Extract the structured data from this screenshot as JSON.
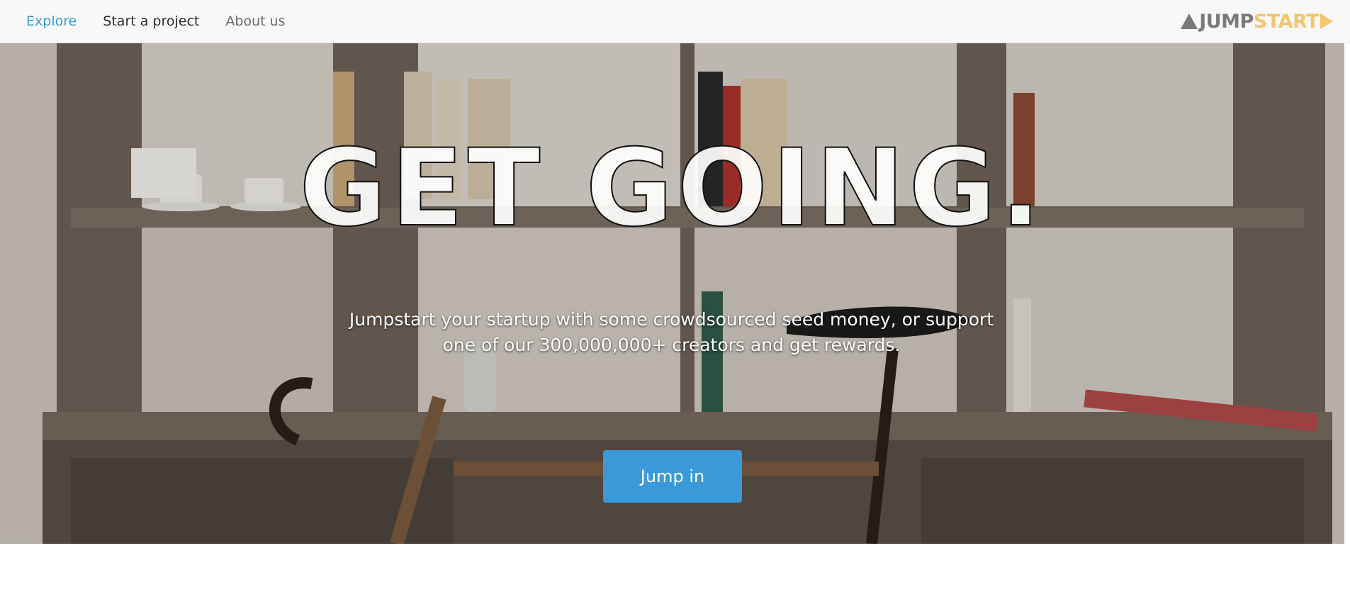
{
  "nav": {
    "links": [
      {
        "label": "Explore"
      },
      {
        "label": "Start a project"
      },
      {
        "label": "About us"
      }
    ],
    "active_color": "#3a9ad9"
  },
  "logo": {
    "part1": "JUMP",
    "part2": "START",
    "color_primary": "#7a7a7a",
    "color_accent": "#f3c56f"
  },
  "hero": {
    "headline": "GET GOING.",
    "subtitle": "Jumpstart your startup with some crowdsourced seed money, or support one of our 300,000,000+ creators and get rewards.",
    "cta_label": "Jump in",
    "cta_color": "#3a9ad9"
  }
}
